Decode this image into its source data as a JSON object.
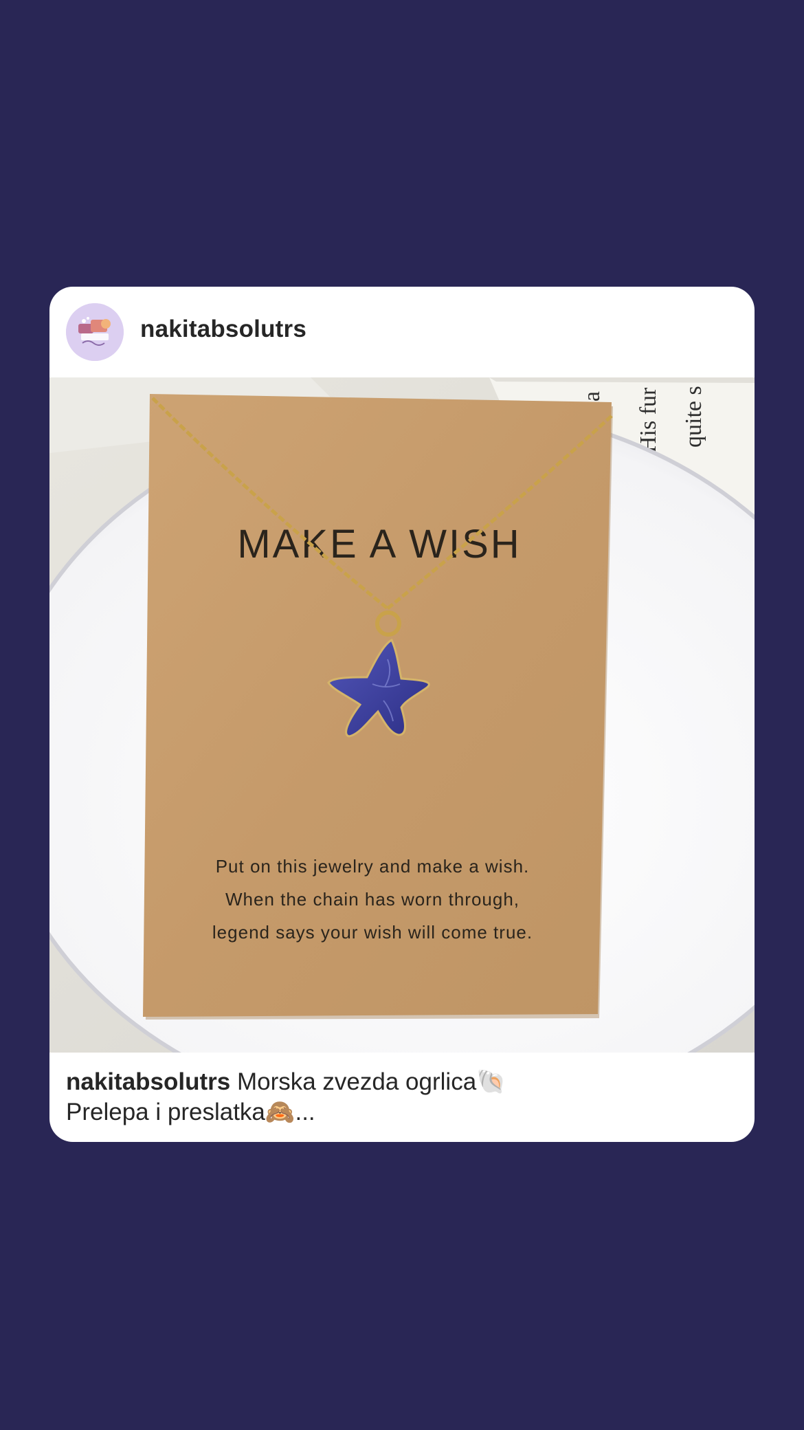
{
  "post": {
    "username": "nakitabsolutrs",
    "caption": {
      "username": "nakitabsolutrs",
      "line1": "Morska zvezda ogrlica",
      "line1_emoji": "🐚",
      "line2": "Prelepa i preslatka",
      "line2_emoji": "🙈",
      "more": "..."
    },
    "image": {
      "card_title": "MAKE A WISH",
      "card_lines": [
        "Put on this jewelry and make a wish.",
        "When the chain has worn through,",
        "legend says your wish will come true."
      ],
      "book_words": [
        "ha",
        "His fur",
        "quite s"
      ]
    }
  },
  "colors": {
    "background": "#292655",
    "card": "#ffffff",
    "kraft": "#c59a6a",
    "starfish": "#3b3f9e",
    "chain": "#c9a24a"
  },
  "icons": {
    "avatar": "jewelry-logo-avatar",
    "pendant": "starfish-pendant"
  }
}
